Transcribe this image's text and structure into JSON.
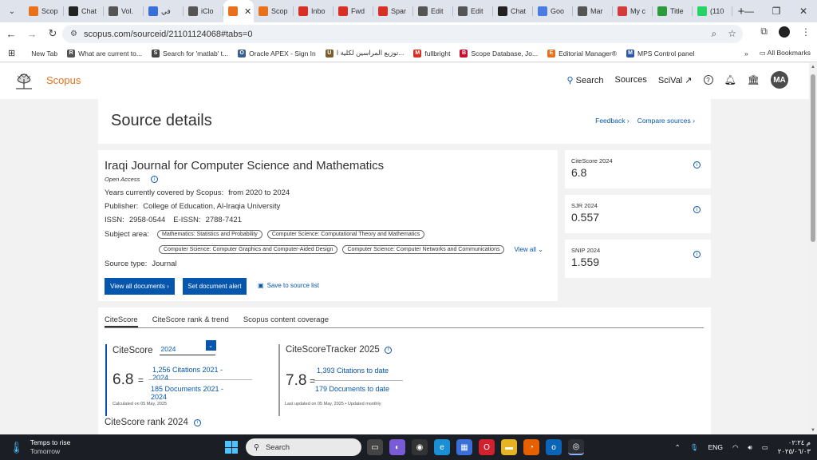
{
  "browser": {
    "tabs": [
      {
        "label": "Scop",
        "icon": "scopus-icon",
        "color": "#e9711c"
      },
      {
        "label": "Chat",
        "icon": "chatgpt-icon",
        "color": "#222222"
      },
      {
        "label": "Vol.",
        "icon": "globe-icon",
        "color": "#555555"
      },
      {
        "label": "في",
        "icon": "edge-icon",
        "color": "#3a6fd8"
      },
      {
        "label": "iClo",
        "icon": "cloud-icon",
        "color": "#555555"
      },
      {
        "label": "",
        "icon": "scopus-icon",
        "color": "#e9711c",
        "active": true
      },
      {
        "label": "Scop",
        "icon": "scopus-icon",
        "color": "#e9711c"
      },
      {
        "label": "Inbo",
        "icon": "gmail-icon",
        "color": "#d93025"
      },
      {
        "label": "Fwd",
        "icon": "gmail-icon",
        "color": "#d93025"
      },
      {
        "label": "Spar",
        "icon": "gmail-icon",
        "color": "#d93025"
      },
      {
        "label": "Edit",
        "icon": "globe-icon",
        "color": "#555555"
      },
      {
        "label": "Edit",
        "icon": "globe-icon",
        "color": "#555555"
      },
      {
        "label": "Chat",
        "icon": "chatgpt-icon",
        "color": "#222222"
      },
      {
        "label": "Goo",
        "icon": "gemini-icon",
        "color": "#4a7be0"
      },
      {
        "label": "Mar",
        "icon": "cloud-icon",
        "color": "#555555"
      },
      {
        "label": "My c",
        "icon": "mylibrary-icon",
        "color": "#d23c3c"
      },
      {
        "label": "Title",
        "icon": "circle-icon",
        "color": "#2e9a3e"
      },
      {
        "label": "(110",
        "icon": "whatsapp-icon",
        "color": "#25d366"
      }
    ],
    "url": "scopus.com/sourceid/21101124068#tabs=0",
    "bookmarks": [
      {
        "label": "New Tab",
        "icon": "",
        "color": "#ffffff"
      },
      {
        "label": "What are current to...",
        "icon": "R",
        "color": "#555555"
      },
      {
        "label": "Search for 'matlab' t...",
        "icon": "S",
        "color": "#444444"
      },
      {
        "label": "Oracle APEX - Sign In",
        "icon": "O",
        "color": "#3a5f8a"
      },
      {
        "label": "توزيع المراسين لكلية ا...",
        "icon": "U",
        "color": "#7a5c2e"
      },
      {
        "label": "fullbright",
        "icon": "M",
        "color": "#d93025"
      },
      {
        "label": "Scope Database, Jo...",
        "icon": "B",
        "color": "#c8102e"
      },
      {
        "label": "Editorial Manager®",
        "icon": "E",
        "color": "#e9711c"
      },
      {
        "label": "MPS Control panel",
        "icon": "M",
        "color": "#2f5aa8"
      }
    ],
    "all_bookmarks": "All Bookmarks"
  },
  "scopus": {
    "logo_text": "Scopus",
    "nav": {
      "search": "Search",
      "sources": "Sources",
      "scival": "SciVal ↗",
      "avatar": "MA"
    }
  },
  "source_details": {
    "title": "Source details",
    "feedback": "Feedback",
    "compare": "Compare sources"
  },
  "journal": {
    "title": "Iraqi Journal for Computer Science and Mathematics",
    "open_access": "Open Access",
    "years_label": "Years currently covered by Scopus:",
    "years_value": "from 2020 to 2024",
    "publisher_label": "Publisher:",
    "publisher_value": "College of Education, Al-Iraqia University",
    "issn_label": "ISSN:",
    "issn_value": "2958-0544",
    "eissn_label": "E-ISSN:",
    "eissn_value": "2788-7421",
    "subject_label": "Subject area:",
    "subjects": [
      "Mathematics: Statistics and Probability",
      "Computer Science: Computational Theory and Mathematics",
      "Computer Science: Computer Graphics and Computer-Aided Design",
      "Computer Science: Computer Networks and Communications"
    ],
    "view_all": "View all",
    "source_type_label": "Source type:",
    "source_type_value": "Journal",
    "btn_view_docs": "View all documents",
    "btn_alert": "Set document alert",
    "save_list": "Save to source list"
  },
  "metrics": [
    {
      "label": "CiteScore 2024",
      "value": "6.8"
    },
    {
      "label": "SJR 2024",
      "value": "0.557"
    },
    {
      "label": "SNIP 2024",
      "value": "1.559"
    }
  ],
  "tabs": [
    "CiteScore",
    "CiteScore rank & trend",
    "Scopus content coverage"
  ],
  "citescore": {
    "heading": "CiteScore",
    "year": "2024",
    "value": "6.8",
    "eq": "=",
    "citations": "1,256 Citations 2021 - 2024",
    "documents": "185 Documents 2021 - 2024",
    "calc_note": "Calculated on 05 May, 2025"
  },
  "tracker": {
    "heading": "CiteScoreTracker 2025",
    "value": "7.8",
    "eq": "=",
    "citations": "1,393 Citations to date",
    "documents": "179 Documents to date",
    "note": "Last updated on 05 May, 2025 • Updated monthly"
  },
  "rank_title": "CiteScore rank 2024",
  "taskbar": {
    "weather_title": "Temps to rise",
    "weather_sub": "Tomorrow",
    "search": "Search",
    "lang": "ENG",
    "time": "م ٠٢:٢٤",
    "date": "٢٠٢٥/٠٦/٠٣"
  }
}
